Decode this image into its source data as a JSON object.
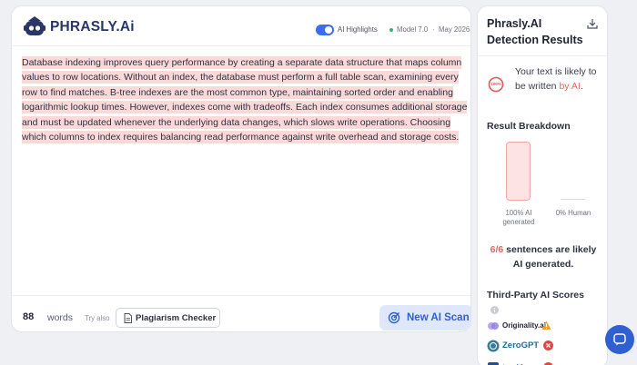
{
  "header": {
    "brand": "PHRASLY.Ai",
    "highlights_label": "AI Highlights",
    "model_label": "Model 7.0",
    "separator": "·",
    "date_label": "May 2026"
  },
  "editor": {
    "text": "Database indexing improves query performance by creating a separate data structure that maps column values to row locations. Without an index, the database must perform a full table scan, examining every row to find matches. B-tree indexes are the most common type, maintaining sorted order and enabling logarithmic lookup times. However, indexes come with tradeoffs. Each index consumes additional storage and must be updated whenever the underlying data changes, which slows write operations. Choosing which columns to index requires balancing read performance against write overhead and storage costs."
  },
  "footer": {
    "word_count": "88",
    "words_label": "words",
    "try_also": "Try also",
    "plagiarism_label": "Plagiarism Checker",
    "scan_label": "New AI Scan"
  },
  "results": {
    "title_line1": "Phrasly.AI",
    "title_line2": "Detection Results",
    "ai_percent_text": "100%",
    "ai_fraction": 1.0,
    "verdict_prefix": "Your text is likely to be written ",
    "verdict_highlight": "by AI",
    "verdict_suffix": ".",
    "breakdown_title": "Result Breakdown",
    "breakdown": {
      "ai_label": "100% AI generated",
      "ai_value": 100,
      "human_label": "0% Human",
      "human_value": 0
    },
    "sentences_ratio": "6/6",
    "sentences_text": "sentences are likely AI generated.",
    "third_party_title": "Third-Party AI Scores",
    "third_party": [
      {
        "name": "Originality.ai",
        "status": "warning"
      },
      {
        "name": "ZeroGPT",
        "status": "fail"
      },
      {
        "name": "turnitin",
        "status": "fail"
      }
    ]
  },
  "colors": {
    "accent": "#2f5fd0",
    "highlight": "#fbd9d9",
    "ai_red": "#e0695f",
    "warning": "#f0a030",
    "fail": "#e04848"
  }
}
